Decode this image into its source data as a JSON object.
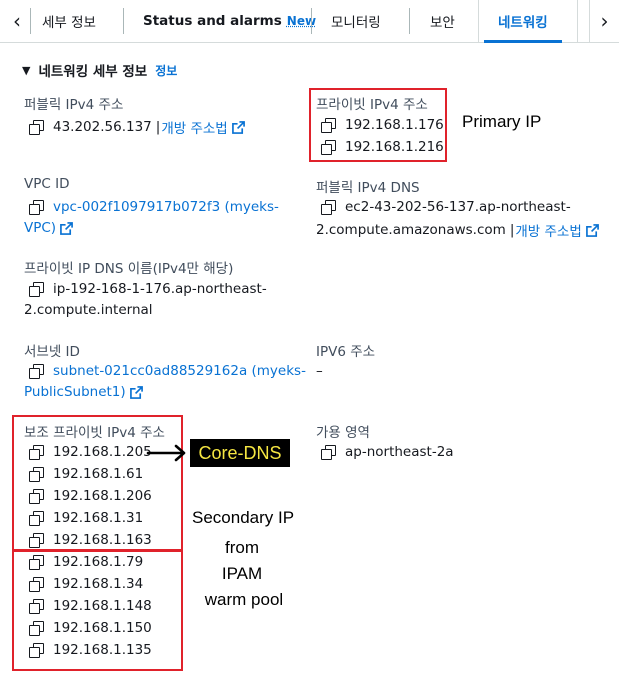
{
  "tabs": [
    {
      "label": "세부 정보"
    },
    {
      "label": "Status and alarms",
      "badge": "New"
    },
    {
      "label": "모니터링"
    },
    {
      "label": "보안"
    },
    {
      "label": "네트워킹"
    }
  ],
  "section": {
    "title": "네트워킹 세부 정보",
    "info": "정보"
  },
  "public_ipv4": {
    "label": "퍼블릭 IPv4 주소",
    "value": "43.202.56.137",
    "link": "개방 주소법"
  },
  "private_ipv4": {
    "label": "프라이빗 IPv4 주소",
    "values": [
      "192.168.1.176",
      "192.168.1.216"
    ]
  },
  "vpc": {
    "label": "VPC ID",
    "line1": "vpc-002f1097917b072f3 (myeks-",
    "line2": "VPC)"
  },
  "public_dns": {
    "label": "퍼블릭 IPv4 DNS",
    "line1": "ec2-43-202-56-137.ap-northeast-",
    "line2": "2.compute.amazonaws.com",
    "link": "개방 주소법"
  },
  "private_dns": {
    "label": "프라이빗 IP DNS 이름(IPv4만 해당)",
    "line1": "ip-192-168-1-176.ap-northeast-",
    "line2": "2.compute.internal"
  },
  "subnet": {
    "label": "서브넷 ID",
    "line1": "subnet-021cc0ad88529162a (myeks-",
    "line2": "PublicSubnet1)"
  },
  "ipv6": {
    "label": "IPV6 주소",
    "value": "–"
  },
  "secondary_ipv4": {
    "label": "보조 프라이빗 IPv4 주소",
    "values": [
      "192.168.1.205",
      "192.168.1.61",
      "192.168.1.206",
      "192.168.1.31",
      "192.168.1.163",
      "192.168.1.79",
      "192.168.1.34",
      "192.168.1.148",
      "192.168.1.150",
      "192.168.1.135"
    ]
  },
  "az": {
    "label": "가용 영역",
    "value": "ap-northeast-2a"
  },
  "annotations": {
    "primary": "Primary IP",
    "core_dns": "Core-DNS",
    "secondary_line1": "Secondary IP",
    "secondary_line2": "from",
    "secondary_line3": "IPAM",
    "secondary_line4": "warm pool"
  },
  "colors": {
    "link": "#0972d3",
    "annotation_box": "#e0222b",
    "core_dns_text": "#f5e642"
  }
}
